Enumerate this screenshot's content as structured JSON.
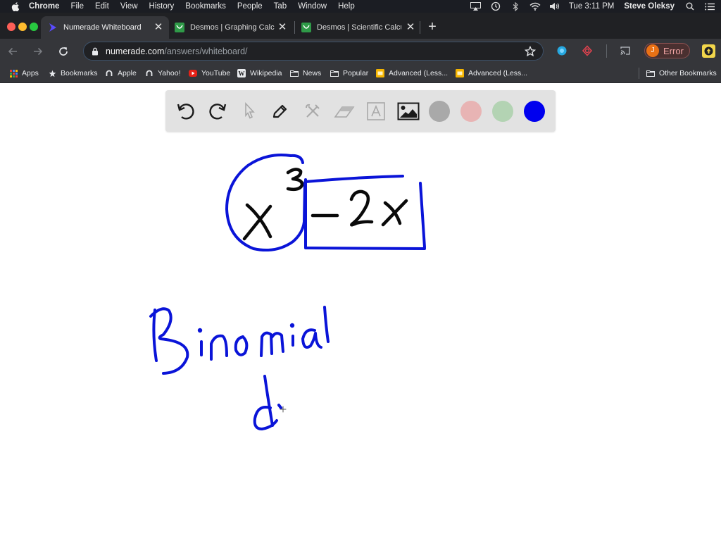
{
  "menubar": {
    "app_name": "Chrome",
    "items": [
      "File",
      "Edit",
      "View",
      "History",
      "Bookmarks",
      "People",
      "Tab",
      "Window",
      "Help"
    ],
    "clock": "Tue 3:11 PM",
    "user": "Steve Oleksy",
    "status_icons": [
      "airplay-icon",
      "time-machine-icon",
      "bluetooth-icon",
      "wifi-icon",
      "volume-icon"
    ]
  },
  "tabs": [
    {
      "title": "Numerade Whiteboard",
      "favicon": "numerade-icon",
      "active": true
    },
    {
      "title": "Desmos | Graphing Calculator",
      "favicon": "desmos-icon",
      "active": false
    },
    {
      "title": "Desmos | Scientific Calculator",
      "favicon": "desmos-icon",
      "active": false
    }
  ],
  "address_bar": {
    "host": "numerade.com",
    "path": "/answers/whiteboard/"
  },
  "profile": {
    "initial": "J",
    "label": "Error"
  },
  "bookmarks": [
    {
      "label": "Apps",
      "icon": "apps-grid-icon"
    },
    {
      "label": "Bookmarks",
      "icon": "star-icon"
    },
    {
      "label": "Apple",
      "icon": "globe-icon"
    },
    {
      "label": "Yahoo!",
      "icon": "globe-icon"
    },
    {
      "label": "YouTube",
      "icon": "youtube-icon"
    },
    {
      "label": "Wikipedia",
      "icon": "wikipedia-icon"
    },
    {
      "label": "News",
      "icon": "folder-icon"
    },
    {
      "label": "Popular",
      "icon": "folder-icon"
    },
    {
      "label": "Advanced (Less...",
      "icon": "slides-icon"
    },
    {
      "label": "Advanced (Less...",
      "icon": "slides-icon"
    }
  ],
  "other_bookmarks": "Other Bookmarks",
  "whiteboard": {
    "tools": [
      "undo",
      "redo",
      "select",
      "pen",
      "tools",
      "eraser",
      "text",
      "image"
    ],
    "active_tool": "pen",
    "colors": [
      {
        "name": "gray",
        "hex": "#a9a9a9"
      },
      {
        "name": "pink",
        "hex": "#e8b4b4"
      },
      {
        "name": "green",
        "hex": "#b3d3b3"
      },
      {
        "name": "blue",
        "hex": "#0000ee"
      }
    ],
    "selected_color": "blue",
    "ink": {
      "black": "#0a0a0a",
      "blue": "#0a14d8"
    },
    "handwritten_content": {
      "expression": "x^3 - 2x",
      "term_circled": "x^3",
      "term_boxed": "-2x",
      "label": "Binomial",
      "partial_text": "d"
    }
  }
}
